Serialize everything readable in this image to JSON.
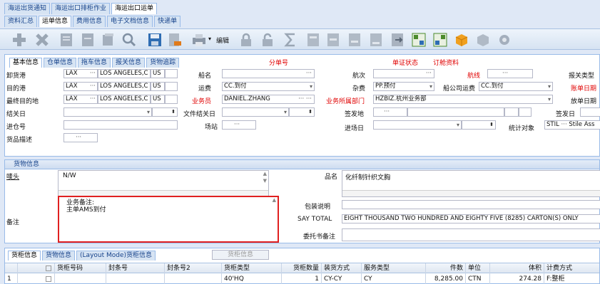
{
  "top_tabs": [
    "海运出货通知",
    "海运出口排柜作业",
    "海运出口运单"
  ],
  "sub_tabs": [
    "资料汇总",
    "运单信息",
    "费用信息",
    "电子文档信息",
    "快递单"
  ],
  "toolbar": {
    "edit_label": "编辑"
  },
  "form_tabs": [
    "基本信息",
    "仓单信息",
    "拖车信息",
    "报关信息",
    "货物追踪"
  ],
  "form": {
    "sub_no_label": "分单号",
    "doc_status_label": "单证状态",
    "booking_label": "订舱资料",
    "pol_label": "卸货港",
    "pol_code": "LAX",
    "pol_name": "LOS ANGELES,C",
    "pol_country": "US",
    "pod_label": "目的港",
    "pod_code": "LAX",
    "pod_name": "LOS ANGELES,C",
    "pod_country": "US",
    "final_label": "最终目的地",
    "final_code": "LAX",
    "final_name": "LOS ANGELES,C",
    "final_country": "US",
    "customs_date_label": "结关日",
    "file_close_label": "文件结关日",
    "warehouse_label": "进仓号",
    "yard_label": "场站",
    "desc_label": "货品描述",
    "vessel_label": "船名",
    "freight_label": "运费",
    "freight_value": "CC.到付",
    "sales_label": "业务员",
    "sales_value": "DANIEL.ZHANG",
    "voyage_label": "航次",
    "route_label": "航线",
    "misc_label": "杂费",
    "misc_value": "PP.预付",
    "ship_freight_label": "船公司运费",
    "ship_freight_value": "CC.到付",
    "dept_label": "业务所属部门",
    "dept_value": "HZBIZ.杭州业务部",
    "sign_place_label": "签发地",
    "enter_date_label": "进场日",
    "stat_label": "统计对象",
    "stat_code": "STIL",
    "stat_name": "Stile Ass",
    "customs_type_label": "报关类型",
    "bill_date_label": "账单日期",
    "release_date_label": "放单日期",
    "issue_date_label": "签发日"
  },
  "cargo": {
    "header": "货物信息",
    "mark_label": "唛头",
    "mark_value": "N/W",
    "product_label": "品名",
    "product_value": "化纤制针织文胸",
    "remark_label": "备注",
    "remark_lines": [
      "业务备注:",
      "主单AMS到付"
    ],
    "pack_label": "包装说明",
    "say_total_label": "SAY TOTAL",
    "say_total_value": "EIGHT THOUSAND TWO HUNDRED AND EIGHTY FIVE (8285) CARTON(S) ONLY",
    "consign_label": "委托书备注"
  },
  "grid": {
    "tabs": [
      "货柜信息",
      "货物信息",
      "(Layout Mode)货柜信息"
    ],
    "button": "货柜信息",
    "columns": [
      "",
      "货柜号码",
      "封条号",
      "封条号2",
      "货柜类型",
      "货柜数量",
      "装货方式",
      "服务类型",
      "件数",
      "单位",
      "体积",
      "计费方式"
    ],
    "row": [
      "1",
      "",
      "",
      "",
      "40'HQ",
      "1",
      "CY-CY",
      "CY",
      "8,285.00",
      "CTN",
      "274.28",
      "F:整柜"
    ]
  },
  "colors": {
    "accent_red": "#e00000",
    "highlight_border": "#e02020",
    "tab_text": "#15428b"
  }
}
